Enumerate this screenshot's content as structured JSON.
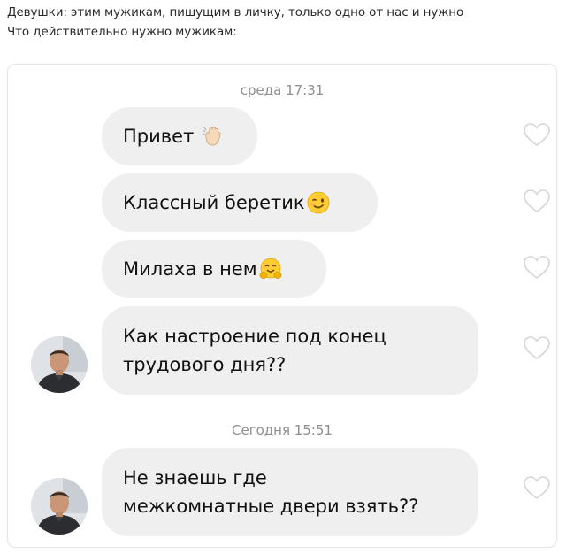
{
  "caption": {
    "line1": "Девушки: этим мужикам, пишущим в личку, только одно от нас и нужно",
    "line2": "Что действительно нужно мужикам:"
  },
  "chat": {
    "timestamps": [
      "среда 17:31",
      "Сегодня 15:51"
    ],
    "messages": [
      {
        "text": "Привет",
        "emoji": "waving-hand-icon"
      },
      {
        "text": "Классный беретик",
        "emoji": "winking-face-icon"
      },
      {
        "text": "Милаха в нем",
        "emoji": "hugging-face-icon"
      },
      {
        "lines": [
          "Как настроение под конец",
          "трудового дня??"
        ]
      },
      {
        "lines": [
          "Не знаешь где",
          "межкомнатные двери взять??"
        ]
      }
    ]
  },
  "colors": {
    "bubble": "#efefef",
    "timestamp": "#8e8e8e",
    "heart_outline": "#d6d6d6"
  }
}
